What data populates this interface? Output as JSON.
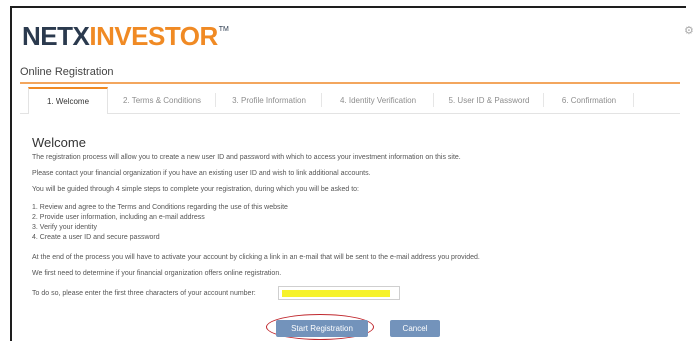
{
  "brand": {
    "part1": "NETX",
    "part2": "INVESTOR",
    "tm": "TM"
  },
  "page": {
    "title": "Online Registration"
  },
  "tabs": [
    {
      "label": "1. Welcome",
      "active": true
    },
    {
      "label": "2. Terms & Conditions",
      "active": false
    },
    {
      "label": "3. Profile Information",
      "active": false
    },
    {
      "label": "4. Identity Verification",
      "active": false
    },
    {
      "label": "5. User ID & Password",
      "active": false
    },
    {
      "label": "6. Confirmation",
      "active": false
    }
  ],
  "welcome": {
    "heading": "Welcome",
    "intro": "The registration process will allow you to create a new user ID and password with which to access your investment information on this site.",
    "contact": "Please contact your financial organization if you have an existing user ID and wish to link additional accounts.",
    "steps_intro": "You will be guided through 4 simple steps to complete your registration, during which you will be asked to:",
    "steps": [
      "1. Review and agree to the Terms and Conditions regarding the use of this website",
      "2. Provide user information, including an e-mail address",
      "3. Verify your identity",
      "4. Create a user ID and secure password"
    ],
    "activation": "At the end of the process you will have to activate your account by clicking a link in an e-mail that will be sent to the e-mail address you provided.",
    "determine": "We first need to determine if your financial organization offers online registration.",
    "account_prompt": "To do so, please enter the first three characters of your account number:",
    "account_value": ""
  },
  "buttons": {
    "start": "Start Registration",
    "cancel": "Cancel"
  },
  "colors": {
    "accent": "#f08a24",
    "navy": "#2b3a4e",
    "button": "#7393bb",
    "highlight": "#f6f22a",
    "annotation": "#c0272d"
  },
  "icons": {
    "top_right": "gear-icon"
  }
}
